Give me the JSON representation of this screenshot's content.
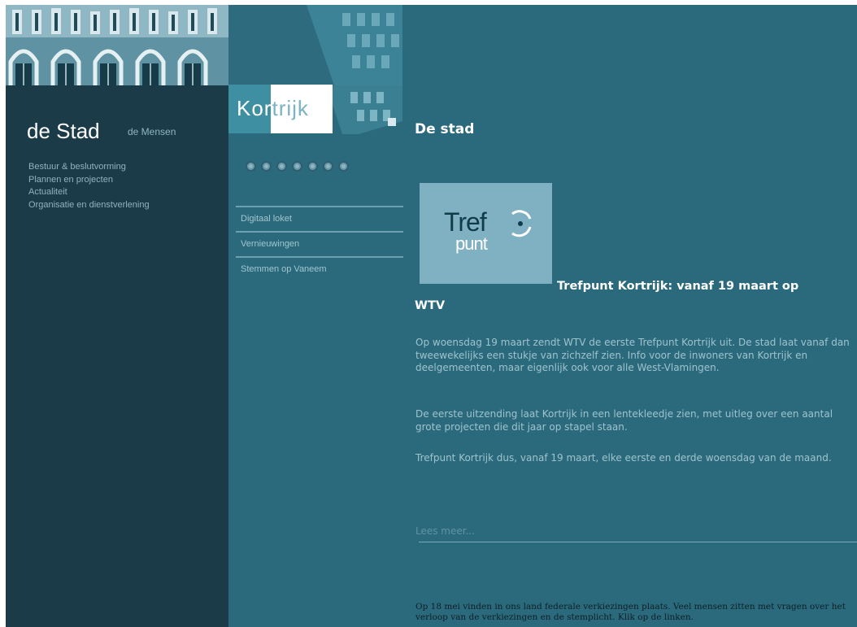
{
  "header": {
    "logo_text_light": "Kor",
    "logo_text_dark": "trijk"
  },
  "sidebar": {
    "heading": "de Stad",
    "secondary_link": "de Mensen",
    "items": [
      {
        "label": "Bestuur & beslutvorming"
      },
      {
        "label": "Plannen en projecten"
      },
      {
        "label": "Actualiteit"
      },
      {
        "label": "Organisatie en dienstverlening"
      }
    ]
  },
  "subnav": {
    "dot_count": 7,
    "items": [
      {
        "label": "Digitaal loket"
      },
      {
        "label": "Vernieuwingen"
      },
      {
        "label": "Stemmen op Vaneem"
      }
    ]
  },
  "main": {
    "title": "De stad",
    "logo_text_top": "Tref",
    "logo_text_bottom": "punt",
    "headline_line1": "Trefpunt Kortrijk: vanaf 19 maart op",
    "headline_line2": "WTV",
    "paragraphs": [
      "Op woensdag 19 maart zendt WTV de eerste Trefpunt Kortrijk uit. De stad laat vanaf dan tweewekelijks een stukje van zichzelf zien. Info voor de inwoners van Kortrijk en deelgemeenten, maar eigenlijk ook voor alle West-Vlamingen.",
      "De eerste uitzending laat Kortrijk in een lentekleedje zien, met uitleg over een aantal grote projecten die dit jaar op stapel staan.",
      "Trefpunt Kortrijk dus, vanaf 19 maart, elke eerste en derde woensdag van de maand."
    ],
    "read_more": "Lees meer...",
    "bottom_text": "Op 18 mei vinden in ons land federale verkiezingen plaats. Veel mensen zitten met vragen over het verloop van de verkiezingen en de stemplicht. Klik op de linken."
  }
}
